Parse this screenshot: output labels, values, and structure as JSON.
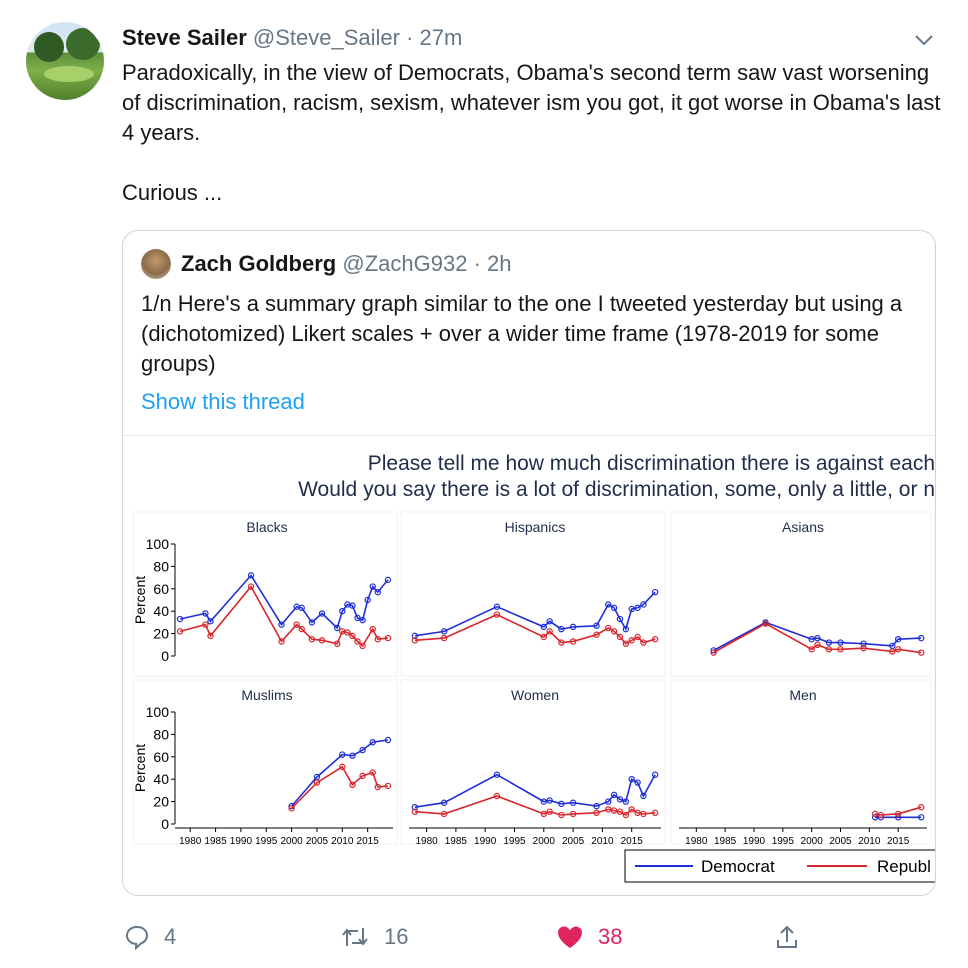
{
  "tweet": {
    "author_name": "Steve Sailer",
    "author_handle": "@Steve_Sailer",
    "separator": "·",
    "time": "27m",
    "text_line1": "Paradoxically, in the view of Democrats, Obama's second term saw vast worsening of discrimination, racism, sexism, whatever ism you got, it got worse in Obama's last 4 years.",
    "text_line2": "Curious ...",
    "avatar_icon": "golf-course-avatar",
    "menu_icon": "chevron-down-icon"
  },
  "quoted": {
    "author_name": "Zach Goldberg",
    "author_handle": "@ZachG932",
    "separator": "·",
    "time": "2h",
    "text": "1/n Here's a summary graph similar to the one I tweeted yesterday but using a (dichotomized) Likert scales + over a wider time frame (1978-2019 for some groups)",
    "show_thread": "Show this thread"
  },
  "actions": {
    "reply_count": "4",
    "retweet_count": "16",
    "like_count": "38",
    "colors": {
      "muted": "#657786",
      "like": "#e0245e",
      "link": "#1da1f2"
    }
  },
  "chart_data": {
    "type": "line",
    "title_line1": "Please tell me how much discrimination there is against each",
    "title_line2": "Would you say there is a lot of discrimination, some, only a little, or n",
    "ylabel": "Percent",
    "ylim": [
      0,
      100
    ],
    "yticks": [
      0,
      20,
      40,
      60,
      80,
      100
    ],
    "xticks": [
      1980,
      1985,
      1990,
      1995,
      2000,
      2005,
      2010,
      2015
    ],
    "xlim": [
      1977,
      2020
    ],
    "legend": [
      "Democrat",
      "Republ"
    ],
    "colors": {
      "Democrat": "#1f2fd6",
      "Republican": "#d8262c"
    },
    "panels": [
      {
        "name": "Blacks",
        "dem": [
          [
            1978,
            33
          ],
          [
            1983,
            38
          ],
          [
            1984,
            31
          ],
          [
            1992,
            72
          ],
          [
            1998,
            28
          ],
          [
            2001,
            44
          ],
          [
            2002,
            43
          ],
          [
            2004,
            30
          ],
          [
            2006,
            38
          ],
          [
            2009,
            25
          ],
          [
            2010,
            40
          ],
          [
            2011,
            46
          ],
          [
            2012,
            45
          ],
          [
            2013,
            34
          ],
          [
            2014,
            32
          ],
          [
            2015,
            50
          ],
          [
            2016,
            62
          ],
          [
            2017,
            57
          ],
          [
            2019,
            68
          ]
        ],
        "rep": [
          [
            1978,
            22
          ],
          [
            1983,
            28
          ],
          [
            1984,
            18
          ],
          [
            1992,
            62
          ],
          [
            1998,
            13
          ],
          [
            2001,
            28
          ],
          [
            2002,
            24
          ],
          [
            2004,
            15
          ],
          [
            2006,
            14
          ],
          [
            2009,
            11
          ],
          [
            2010,
            22
          ],
          [
            2011,
            21
          ],
          [
            2012,
            18
          ],
          [
            2013,
            13
          ],
          [
            2014,
            9
          ],
          [
            2016,
            24
          ],
          [
            2017,
            15
          ],
          [
            2019,
            16
          ]
        ]
      },
      {
        "name": "Hispanics",
        "dem": [
          [
            1978,
            18
          ],
          [
            1983,
            22
          ],
          [
            1992,
            44
          ],
          [
            2000,
            26
          ],
          [
            2001,
            31
          ],
          [
            2003,
            24
          ],
          [
            2005,
            26
          ],
          [
            2009,
            27
          ],
          [
            2011,
            46
          ],
          [
            2012,
            43
          ],
          [
            2013,
            33
          ],
          [
            2014,
            24
          ],
          [
            2015,
            42
          ],
          [
            2016,
            43
          ],
          [
            2017,
            46
          ],
          [
            2019,
            57
          ]
        ],
        "rep": [
          [
            1978,
            14
          ],
          [
            1983,
            16
          ],
          [
            1992,
            37
          ],
          [
            2000,
            17
          ],
          [
            2001,
            22
          ],
          [
            2003,
            12
          ],
          [
            2005,
            13
          ],
          [
            2009,
            19
          ],
          [
            2011,
            25
          ],
          [
            2012,
            22
          ],
          [
            2013,
            17
          ],
          [
            2014,
            11
          ],
          [
            2015,
            14
          ],
          [
            2016,
            17
          ],
          [
            2017,
            12
          ],
          [
            2019,
            15
          ]
        ]
      },
      {
        "name": "Asians",
        "dem": [
          [
            1983,
            5
          ],
          [
            1992,
            30
          ],
          [
            2000,
            15
          ],
          [
            2001,
            16
          ],
          [
            2003,
            12
          ],
          [
            2005,
            12
          ],
          [
            2009,
            11
          ],
          [
            2014,
            9
          ],
          [
            2015,
            15
          ],
          [
            2019,
            16
          ]
        ],
        "rep": [
          [
            1983,
            3
          ],
          [
            1992,
            29
          ],
          [
            2000,
            6
          ],
          [
            2001,
            10
          ],
          [
            2003,
            6
          ],
          [
            2005,
            6
          ],
          [
            2009,
            7
          ],
          [
            2014,
            4
          ],
          [
            2015,
            6
          ],
          [
            2019,
            3
          ]
        ]
      },
      {
        "name": "Muslims",
        "dem": [
          [
            2000,
            16
          ],
          [
            2005,
            42
          ],
          [
            2010,
            62
          ],
          [
            2012,
            61
          ],
          [
            2014,
            66
          ],
          [
            2016,
            73
          ],
          [
            2019,
            75
          ]
        ],
        "rep": [
          [
            2000,
            14
          ],
          [
            2005,
            37
          ],
          [
            2010,
            51
          ],
          [
            2012,
            35
          ],
          [
            2014,
            43
          ],
          [
            2016,
            46
          ],
          [
            2017,
            33
          ],
          [
            2019,
            34
          ]
        ]
      },
      {
        "name": "Women",
        "dem": [
          [
            1978,
            15
          ],
          [
            1983,
            19
          ],
          [
            1992,
            44
          ],
          [
            2000,
            20
          ],
          [
            2001,
            21
          ],
          [
            2003,
            18
          ],
          [
            2005,
            19
          ],
          [
            2009,
            16
          ],
          [
            2011,
            20
          ],
          [
            2012,
            26
          ],
          [
            2013,
            22
          ],
          [
            2014,
            20
          ],
          [
            2015,
            40
          ],
          [
            2016,
            37
          ],
          [
            2017,
            25
          ],
          [
            2019,
            44
          ]
        ],
        "rep": [
          [
            1978,
            11
          ],
          [
            1983,
            9
          ],
          [
            1992,
            25
          ],
          [
            2000,
            9
          ],
          [
            2001,
            11
          ],
          [
            2003,
            8
          ],
          [
            2005,
            9
          ],
          [
            2009,
            10
          ],
          [
            2011,
            13
          ],
          [
            2012,
            12
          ],
          [
            2013,
            11
          ],
          [
            2014,
            8
          ],
          [
            2015,
            13
          ],
          [
            2016,
            10
          ],
          [
            2017,
            9
          ],
          [
            2019,
            10
          ]
        ]
      },
      {
        "name": "Men",
        "dem": [
          [
            2011,
            6
          ],
          [
            2012,
            6
          ],
          [
            2015,
            6
          ],
          [
            2019,
            6
          ]
        ],
        "rep": [
          [
            2011,
            9
          ],
          [
            2012,
            8
          ],
          [
            2015,
            9
          ],
          [
            2019,
            15
          ]
        ]
      }
    ]
  }
}
